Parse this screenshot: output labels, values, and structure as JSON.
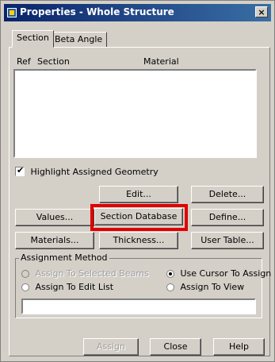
{
  "window": {
    "title": "Properties - Whole Structure",
    "close_label": "×"
  },
  "tabs": [
    {
      "label": "Section",
      "active": true
    },
    {
      "label": "Beta Angle",
      "active": false
    }
  ],
  "list": {
    "columns": [
      "Ref",
      "Section",
      "Material"
    ],
    "rows": []
  },
  "highlight_checkbox": {
    "label": "Highlight Assigned Geometry",
    "checked": true
  },
  "buttons": {
    "edit": "Edit...",
    "delete": "Delete...",
    "values": "Values...",
    "section_database": "Section Database",
    "define": "Define...",
    "materials": "Materials...",
    "thickness": "Thickness...",
    "user_table": "User Table..."
  },
  "assignment_method": {
    "title": "Assignment Method",
    "options": [
      {
        "label": "Assign To Selected Beams",
        "enabled": false,
        "checked": false
      },
      {
        "label": "Use Cursor To Assign",
        "enabled": true,
        "checked": true
      },
      {
        "label": "Assign To Edit List",
        "enabled": true,
        "checked": false
      },
      {
        "label": "Assign To View",
        "enabled": true,
        "checked": false
      }
    ],
    "edit_list_value": ""
  },
  "footer": {
    "assign": "Assign",
    "close": "Close",
    "help": "Help"
  },
  "colors": {
    "title_bar": "#0a246a",
    "highlight_box": "#e00000",
    "dialog_face": "#d4d0c8"
  }
}
